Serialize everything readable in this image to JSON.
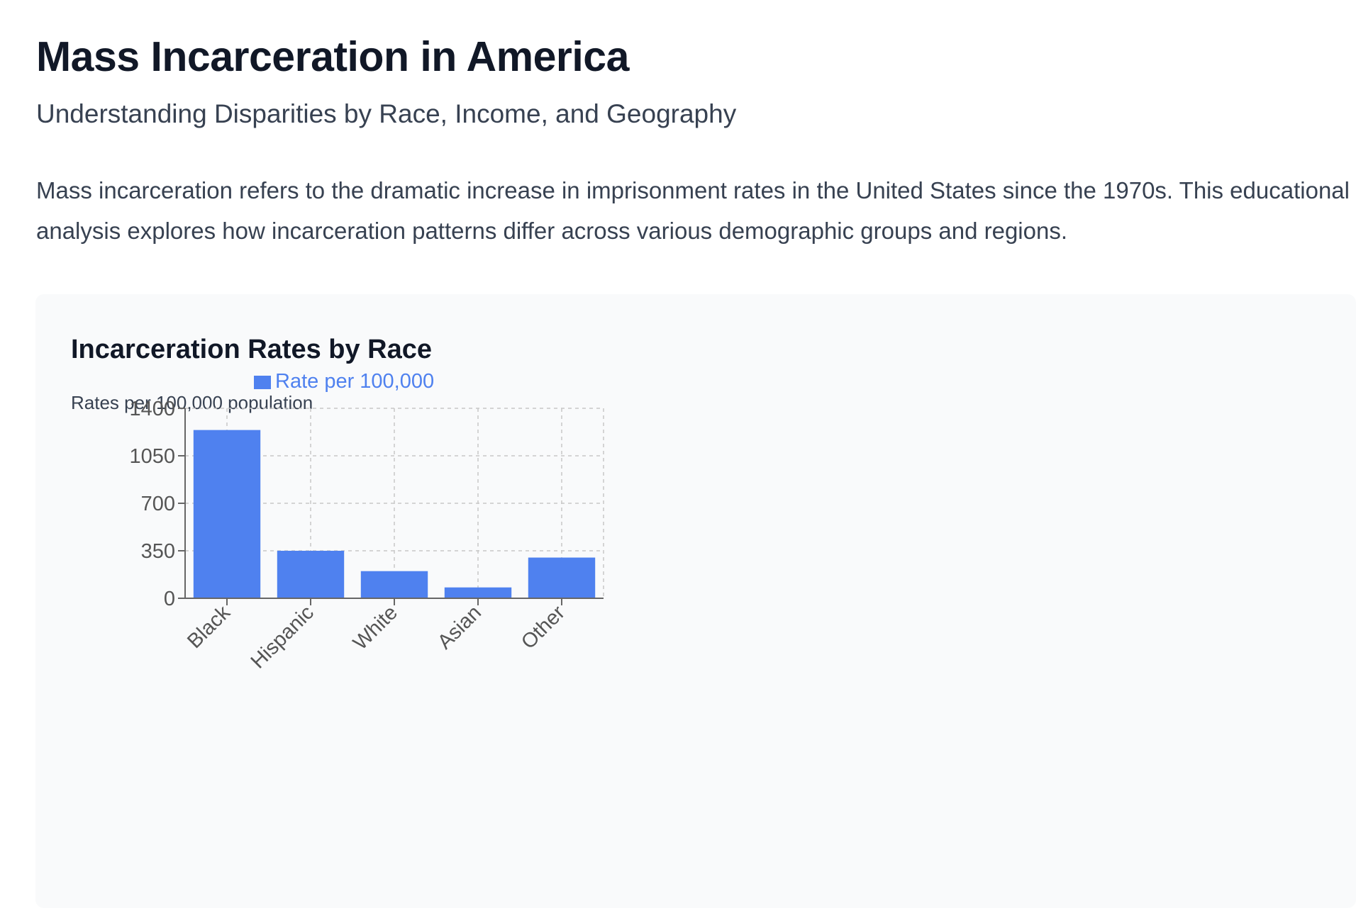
{
  "header": {
    "title": "Mass Incarceration in America",
    "subtitle": "Understanding Disparities by Race, Income, and Geography"
  },
  "intro": {
    "text": "Mass incarceration refers to the dramatic increase in imprisonment rates in the United States since the 1970s. This educational analysis explores how incarceration patterns differ across various demographic groups and regions."
  },
  "chart_card": {
    "title": "Incarceration Rates by Race",
    "note": "Rates per 100,000 population"
  },
  "colors": {
    "bar": "#4f81ef",
    "legend_text": "#4f81ef",
    "grid": "#c8c8c8",
    "axis": "#666666",
    "tick_text": "#555555"
  },
  "chart_data": {
    "type": "bar",
    "categories": [
      "Black",
      "Hispanic",
      "White",
      "Asian",
      "Other"
    ],
    "series": [
      {
        "name": "Rate per 100,000",
        "values": [
          1240,
          350,
          200,
          80,
          300
        ]
      }
    ],
    "yticks": [
      0,
      350,
      700,
      1050,
      1400
    ],
    "ylim": [
      0,
      1400
    ],
    "grid": true,
    "legend": "top"
  }
}
